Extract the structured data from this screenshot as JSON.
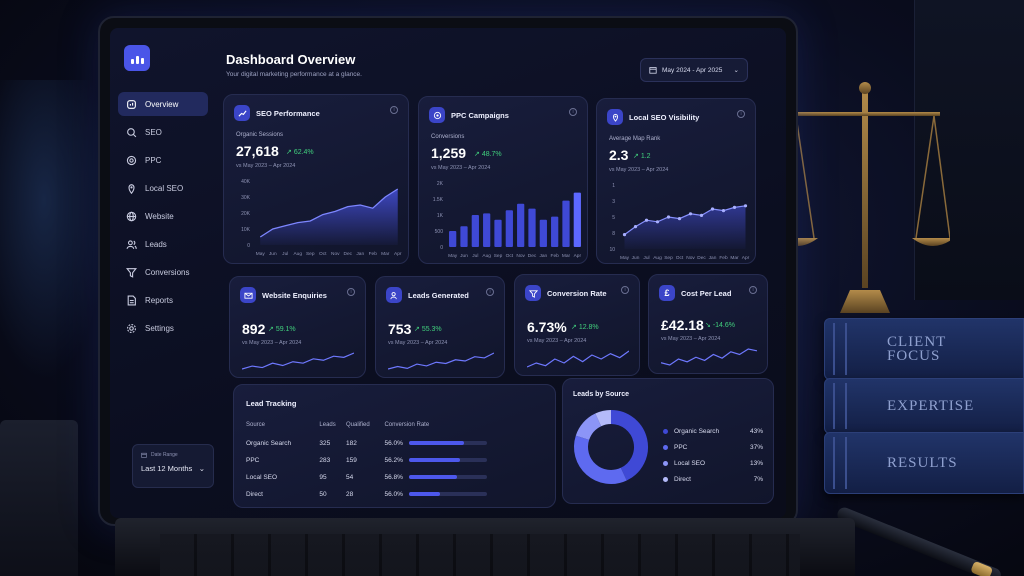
{
  "header": {
    "title": "Dashboard Overview",
    "subtitle": "Your digital marketing performance at a glance.",
    "period": "May 2024 - Apr 2025"
  },
  "sidebar": {
    "items": [
      {
        "label": "Overview",
        "icon": "dashboard-icon",
        "active": true
      },
      {
        "label": "SEO",
        "icon": "search-icon"
      },
      {
        "label": "PPC",
        "icon": "target-icon"
      },
      {
        "label": "Local SEO",
        "icon": "map-pin-icon"
      },
      {
        "label": "Website",
        "icon": "globe-icon"
      },
      {
        "label": "Leads",
        "icon": "users-icon"
      },
      {
        "label": "Conversions",
        "icon": "funnel-icon"
      },
      {
        "label": "Reports",
        "icon": "document-icon"
      },
      {
        "label": "Settings",
        "icon": "gear-icon"
      }
    ],
    "date_range": {
      "label": "Date Range",
      "value": "Last 12 Months"
    }
  },
  "cards": {
    "seo": {
      "title": "SEO Performance",
      "metric_label": "Organic Sessions",
      "value": "27,618",
      "delta": "62.4%",
      "compare": "vs May 2023 – Apr 2024"
    },
    "ppc": {
      "title": "PPC Campaigns",
      "metric_label": "Conversions",
      "value": "1,259",
      "delta": "48.7%",
      "compare": "vs May 2023 – Apr 2024"
    },
    "local": {
      "title": "Local SEO Visibility",
      "metric_label": "Average Map Rank",
      "value": "2.3",
      "delta": "1.2",
      "compare": "vs May 2023 – Apr 2024"
    },
    "enquiries": {
      "title": "Website Enquiries",
      "value": "892",
      "delta": "59.1%",
      "compare": "vs May 2023 – Apr 2024"
    },
    "leads": {
      "title": "Leads Generated",
      "value": "753",
      "delta": "55.3%",
      "compare": "vs May 2023 – Apr 2024"
    },
    "conversion": {
      "title": "Conversion Rate",
      "value": "6.73%",
      "delta": "12.8%",
      "compare": "vs May 2023 – Apr 2024"
    },
    "cpl": {
      "title": "Cost Per Lead",
      "value": "£42.18",
      "delta": "-14.6%",
      "compare": "vs May 2023 – Apr 2024"
    }
  },
  "lead_tracking": {
    "title": "Lead Tracking",
    "columns": [
      "Source",
      "Leads",
      "Qualified",
      "Conversion Rate"
    ],
    "rows": [
      {
        "source": "Organic Search",
        "leads": "325",
        "qualified": "182",
        "rate": "56.0%",
        "fill": 0.7
      },
      {
        "source": "PPC",
        "leads": "283",
        "qualified": "159",
        "rate": "56.2%",
        "fill": 0.66
      },
      {
        "source": "Local SEO",
        "leads": "95",
        "qualified": "54",
        "rate": "56.8%",
        "fill": 0.62
      },
      {
        "source": "Direct",
        "leads": "50",
        "qualified": "28",
        "rate": "56.0%",
        "fill": 0.4
      }
    ]
  },
  "leads_by_source": {
    "title": "Leads by Source",
    "items": [
      {
        "label": "Organic Search",
        "pct": "43%",
        "value": 43,
        "color": "#3f49d6"
      },
      {
        "label": "PPC",
        "pct": "37%",
        "value": 37,
        "color": "#5e6af0"
      },
      {
        "label": "Local SEO",
        "pct": "13%",
        "value": 13,
        "color": "#8c95f7"
      },
      {
        "label": "Direct",
        "pct": "7%",
        "value": 7,
        "color": "#b4baf9"
      }
    ]
  },
  "chart_data": [
    {
      "type": "area",
      "categories": [
        "May",
        "Jun",
        "Jul",
        "Aug",
        "Sep",
        "Oct",
        "Nov",
        "Dec",
        "Jan",
        "Feb",
        "Mar",
        "Apr"
      ],
      "values": [
        5000,
        10000,
        12000,
        14000,
        15000,
        19000,
        21000,
        24000,
        25000,
        23000,
        30000,
        35000
      ],
      "yticks": [
        "40K",
        "30K",
        "20K",
        "10K",
        "0"
      ],
      "ylim": [
        0,
        40000
      ]
    },
    {
      "type": "bar",
      "categories": [
        "May",
        "Jun",
        "Jul",
        "Aug",
        "Sep",
        "Oct",
        "Nov",
        "Dec",
        "Jan",
        "Feb",
        "Mar",
        "Apr"
      ],
      "values": [
        500,
        650,
        1000,
        1050,
        850,
        1150,
        1350,
        1200,
        850,
        950,
        1450,
        1700
      ],
      "yticks": [
        "2K",
        "1.5K",
        "1K",
        "500",
        "0"
      ],
      "ylim": [
        0,
        2000
      ]
    },
    {
      "type": "line",
      "categories": [
        "May",
        "Jun",
        "Jul",
        "Aug",
        "Sep",
        "Oct",
        "Nov",
        "Dec",
        "Jan",
        "Feb",
        "Mar",
        "Apr"
      ],
      "values": [
        4.1,
        3.6,
        3.2,
        3.3,
        3.0,
        3.1,
        2.8,
        2.9,
        2.5,
        2.6,
        2.4,
        2.3
      ],
      "yticks": [
        "1",
        "3",
        "5",
        "8",
        "10"
      ]
    },
    {
      "type": "donut",
      "categories": [
        "Organic Search",
        "PPC",
        "Local SEO",
        "Direct"
      ],
      "values": [
        43,
        37,
        13,
        7
      ]
    }
  ],
  "sparklines": {
    "enquiries": [
      3,
      4,
      3.5,
      5,
      4.2,
      5.5,
      5,
      6.5,
      6,
      7.4,
      7,
      8.5
    ],
    "leads": [
      3,
      3.8,
      3.2,
      4.6,
      4,
      5.2,
      4.8,
      6,
      5.6,
      7,
      6.6,
      8.2
    ],
    "conversion": [
      3,
      4.5,
      3.5,
      6,
      4.5,
      7,
      5,
      7.5,
      6,
      8,
      6.5,
      9
    ],
    "cpl": [
      4,
      3.5,
      4.8,
      4.2,
      5.2,
      4.5,
      5.8,
      5,
      6.4,
      5.8,
      7,
      6.6
    ]
  }
}
